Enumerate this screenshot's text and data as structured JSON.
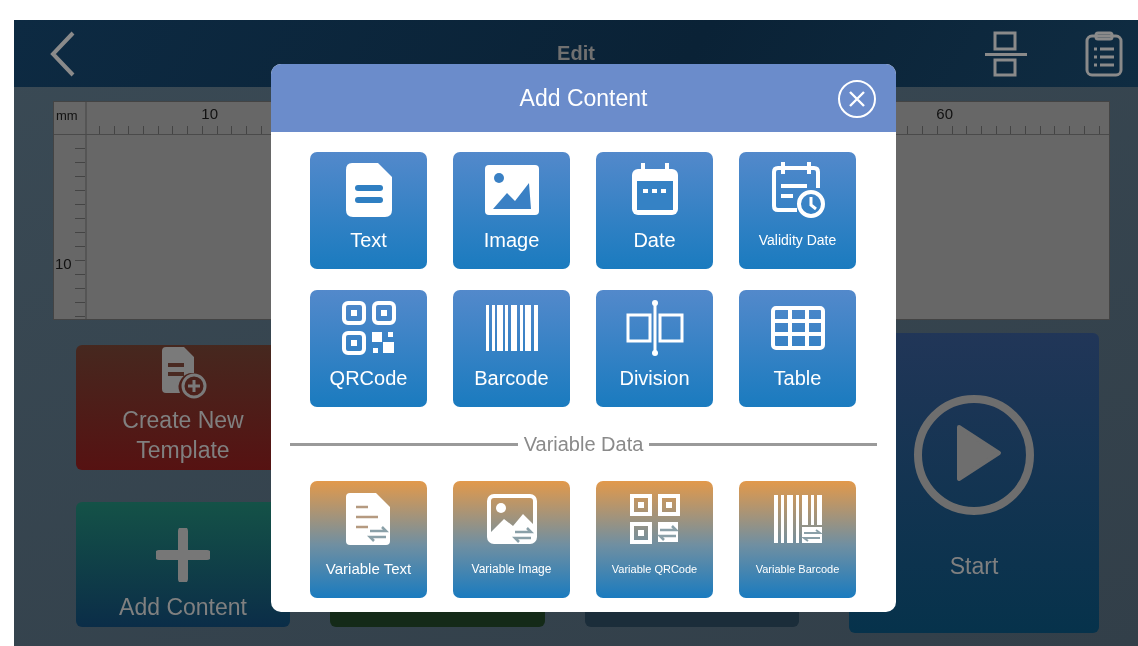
{
  "header": {
    "title": "Edit"
  },
  "ruler": {
    "unit": "mm",
    "top_labels": [
      "10",
      "60"
    ],
    "left_labels": [
      "10"
    ]
  },
  "tiles": [
    {
      "kind": "new-template",
      "label": "Create New Template"
    },
    {
      "kind": "add-content",
      "label": "Add Content"
    },
    {
      "kind": "blank-green"
    },
    {
      "kind": "blank-navy"
    },
    {
      "kind": "start",
      "label": "Start"
    }
  ],
  "dialog": {
    "title": "Add Content",
    "items": [
      {
        "kind": "text",
        "label": "Text"
      },
      {
        "kind": "image",
        "label": "Image"
      },
      {
        "kind": "date",
        "label": "Date"
      },
      {
        "kind": "validity-date",
        "label": "Validity Date"
      },
      {
        "kind": "qrcode",
        "label": "QRCode"
      },
      {
        "kind": "barcode",
        "label": "Barcode"
      },
      {
        "kind": "division",
        "label": "Division"
      },
      {
        "kind": "table",
        "label": "Table"
      }
    ],
    "section": "Variable Data",
    "variable_items": [
      {
        "kind": "variable-text",
        "label": "Variable Text"
      },
      {
        "kind": "variable-image",
        "label": "Variable Image"
      },
      {
        "kind": "variable-qrcode",
        "label": "Variable QRCode"
      },
      {
        "kind": "variable-barcode",
        "label": "Variable Barcode"
      }
    ]
  }
}
